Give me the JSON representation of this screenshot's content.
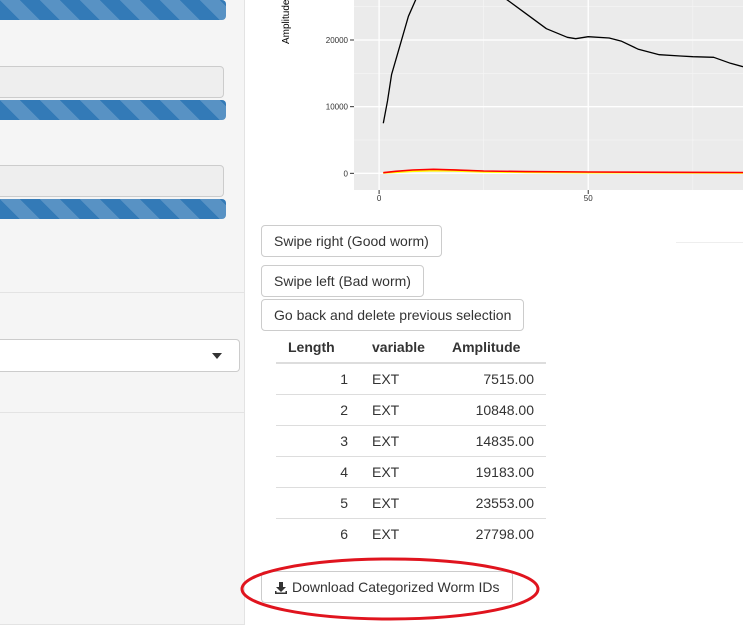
{
  "sidebar": {
    "progress": [
      {
        "percent": 100
      },
      {
        "percent": 100
      },
      {
        "percent": 100
      }
    ],
    "select": {
      "value": ""
    }
  },
  "chart_data": {
    "type": "line",
    "title": "",
    "xlabel": "",
    "ylabel": "Amplitude",
    "xlim": [
      -6,
      87
    ],
    "ylim": [
      -2500,
      26000
    ],
    "x_ticks": [
      "0",
      "50"
    ],
    "y_ticks": [
      "0",
      "10000",
      "20000"
    ],
    "grid": true,
    "series": [
      {
        "color": "#000000",
        "x": [
          1,
          2,
          3,
          5,
          7,
          10,
          15,
          20,
          25,
          30,
          35,
          40,
          45,
          47,
          50,
          55,
          58,
          62,
          67,
          72,
          75,
          80,
          84,
          87
        ],
        "y": [
          7515,
          10848,
          14835,
          19183,
          23553,
          27798,
          32000,
          31500,
          28500,
          26300,
          24000,
          21700,
          20400,
          20200,
          20500,
          20300,
          19800,
          18600,
          17800,
          17600,
          17500,
          17400,
          16500,
          16000
        ]
      },
      {
        "color": "#ffa500",
        "x": [
          1,
          4,
          8,
          13,
          18,
          25,
          35,
          50,
          70,
          87
        ],
        "y": [
          80,
          250,
          450,
          550,
          480,
          300,
          200,
          150,
          100,
          80
        ]
      },
      {
        "color": "#ffff00",
        "x": [
          1,
          4,
          8,
          13,
          18,
          25,
          35,
          50,
          70,
          87
        ],
        "y": [
          60,
          150,
          300,
          400,
          350,
          220,
          150,
          100,
          80,
          60
        ]
      },
      {
        "color": "#ff0000",
        "x": [
          1,
          4,
          8,
          13,
          18,
          25,
          35,
          50,
          70,
          87
        ],
        "y": [
          100,
          300,
          500,
          600,
          520,
          350,
          260,
          200,
          150,
          120
        ]
      }
    ]
  },
  "buttons": {
    "swipe_right": "Swipe right (Good worm)",
    "swipe_left": "Swipe left (Bad worm)",
    "go_back": "Go back and delete previous selection",
    "download": "Download Categorized Worm IDs"
  },
  "table": {
    "headers": [
      "Length",
      "variable",
      "Amplitude"
    ],
    "rows": [
      [
        "1",
        "EXT",
        "7515.00"
      ],
      [
        "2",
        "EXT",
        "10848.00"
      ],
      [
        "3",
        "EXT",
        "14835.00"
      ],
      [
        "4",
        "EXT",
        "19183.00"
      ],
      [
        "5",
        "EXT",
        "23553.00"
      ],
      [
        "6",
        "EXT",
        "27798.00"
      ]
    ]
  },
  "icons": {
    "download": "download-icon"
  },
  "colors": {
    "progress": "#337ab7",
    "highlight_ellipse": "#e0141e"
  }
}
